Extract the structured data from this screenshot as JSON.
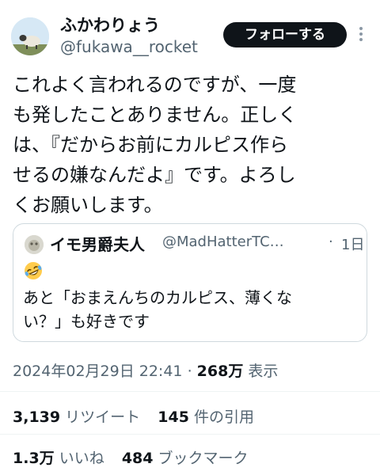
{
  "author": {
    "display_name": "ふかわりょう",
    "handle": "@fukawa__rocket",
    "avatar_icon": "sheep-avatar-icon"
  },
  "follow_button": {
    "label": "フォローする"
  },
  "more_icon": "more-vertical-icon",
  "tweet": {
    "lines": [
      "これよく言われるのですが、一度",
      "も発したことありません。正しく",
      "は、『だからお前にカルピス作ら",
      "せるの嫌なんだよ』です。よろし",
      "くお願いします。"
    ]
  },
  "quote": {
    "name": "イモ男爵夫人",
    "handle": "@MadHatterTC…",
    "separator": "·",
    "time": "1日",
    "emoji_icon": "rolling-laughing-emoji-icon",
    "lines": [
      "あと「おまえんちのカルピス、薄くな",
      "い？」も好きです"
    ]
  },
  "meta": {
    "timestamp": "2024年02月29日 22:41",
    "separator": "·",
    "views_count": "268万",
    "views_label": "表示"
  },
  "stats": {
    "retweets_count": "3,139",
    "retweets_label": "リツイート",
    "quotes_count": "145",
    "quotes_label": "件の引用",
    "likes_count": "1.3万",
    "likes_label": "いいね",
    "bookmarks_count": "484",
    "bookmarks_label": "ブックマーク"
  },
  "colors": {
    "text_primary": "#0f1419",
    "text_secondary": "#536471",
    "border": "#cfd9de",
    "button_bg": "#0f1419"
  }
}
